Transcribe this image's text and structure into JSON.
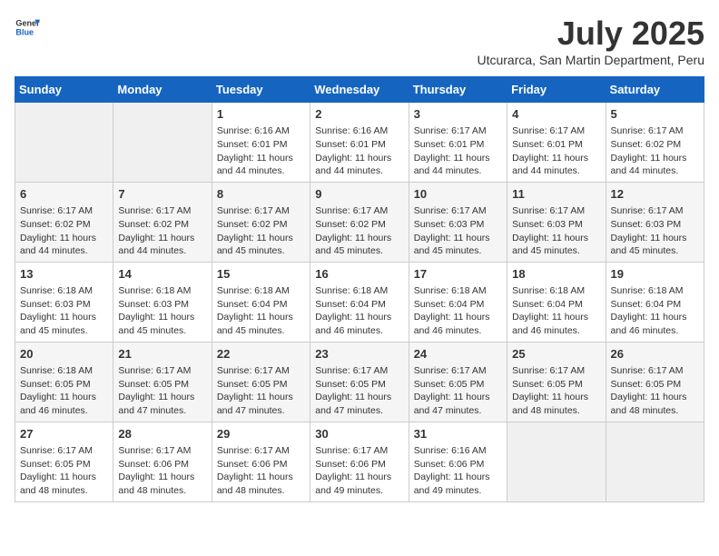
{
  "header": {
    "logo_general": "General",
    "logo_blue": "Blue",
    "month": "July 2025",
    "location": "Utcurarca, San Martin Department, Peru"
  },
  "days_of_week": [
    "Sunday",
    "Monday",
    "Tuesday",
    "Wednesday",
    "Thursday",
    "Friday",
    "Saturday"
  ],
  "weeks": [
    [
      {
        "day": "",
        "sunrise": "",
        "sunset": "",
        "daylight": ""
      },
      {
        "day": "",
        "sunrise": "",
        "sunset": "",
        "daylight": ""
      },
      {
        "day": "1",
        "sunrise": "Sunrise: 6:16 AM",
        "sunset": "Sunset: 6:01 PM",
        "daylight": "Daylight: 11 hours and 44 minutes."
      },
      {
        "day": "2",
        "sunrise": "Sunrise: 6:16 AM",
        "sunset": "Sunset: 6:01 PM",
        "daylight": "Daylight: 11 hours and 44 minutes."
      },
      {
        "day": "3",
        "sunrise": "Sunrise: 6:17 AM",
        "sunset": "Sunset: 6:01 PM",
        "daylight": "Daylight: 11 hours and 44 minutes."
      },
      {
        "day": "4",
        "sunrise": "Sunrise: 6:17 AM",
        "sunset": "Sunset: 6:01 PM",
        "daylight": "Daylight: 11 hours and 44 minutes."
      },
      {
        "day": "5",
        "sunrise": "Sunrise: 6:17 AM",
        "sunset": "Sunset: 6:02 PM",
        "daylight": "Daylight: 11 hours and 44 minutes."
      }
    ],
    [
      {
        "day": "6",
        "sunrise": "Sunrise: 6:17 AM",
        "sunset": "Sunset: 6:02 PM",
        "daylight": "Daylight: 11 hours and 44 minutes."
      },
      {
        "day": "7",
        "sunrise": "Sunrise: 6:17 AM",
        "sunset": "Sunset: 6:02 PM",
        "daylight": "Daylight: 11 hours and 44 minutes."
      },
      {
        "day": "8",
        "sunrise": "Sunrise: 6:17 AM",
        "sunset": "Sunset: 6:02 PM",
        "daylight": "Daylight: 11 hours and 45 minutes."
      },
      {
        "day": "9",
        "sunrise": "Sunrise: 6:17 AM",
        "sunset": "Sunset: 6:02 PM",
        "daylight": "Daylight: 11 hours and 45 minutes."
      },
      {
        "day": "10",
        "sunrise": "Sunrise: 6:17 AM",
        "sunset": "Sunset: 6:03 PM",
        "daylight": "Daylight: 11 hours and 45 minutes."
      },
      {
        "day": "11",
        "sunrise": "Sunrise: 6:17 AM",
        "sunset": "Sunset: 6:03 PM",
        "daylight": "Daylight: 11 hours and 45 minutes."
      },
      {
        "day": "12",
        "sunrise": "Sunrise: 6:17 AM",
        "sunset": "Sunset: 6:03 PM",
        "daylight": "Daylight: 11 hours and 45 minutes."
      }
    ],
    [
      {
        "day": "13",
        "sunrise": "Sunrise: 6:18 AM",
        "sunset": "Sunset: 6:03 PM",
        "daylight": "Daylight: 11 hours and 45 minutes."
      },
      {
        "day": "14",
        "sunrise": "Sunrise: 6:18 AM",
        "sunset": "Sunset: 6:03 PM",
        "daylight": "Daylight: 11 hours and 45 minutes."
      },
      {
        "day": "15",
        "sunrise": "Sunrise: 6:18 AM",
        "sunset": "Sunset: 6:04 PM",
        "daylight": "Daylight: 11 hours and 45 minutes."
      },
      {
        "day": "16",
        "sunrise": "Sunrise: 6:18 AM",
        "sunset": "Sunset: 6:04 PM",
        "daylight": "Daylight: 11 hours and 46 minutes."
      },
      {
        "day": "17",
        "sunrise": "Sunrise: 6:18 AM",
        "sunset": "Sunset: 6:04 PM",
        "daylight": "Daylight: 11 hours and 46 minutes."
      },
      {
        "day": "18",
        "sunrise": "Sunrise: 6:18 AM",
        "sunset": "Sunset: 6:04 PM",
        "daylight": "Daylight: 11 hours and 46 minutes."
      },
      {
        "day": "19",
        "sunrise": "Sunrise: 6:18 AM",
        "sunset": "Sunset: 6:04 PM",
        "daylight": "Daylight: 11 hours and 46 minutes."
      }
    ],
    [
      {
        "day": "20",
        "sunrise": "Sunrise: 6:18 AM",
        "sunset": "Sunset: 6:05 PM",
        "daylight": "Daylight: 11 hours and 46 minutes."
      },
      {
        "day": "21",
        "sunrise": "Sunrise: 6:17 AM",
        "sunset": "Sunset: 6:05 PM",
        "daylight": "Daylight: 11 hours and 47 minutes."
      },
      {
        "day": "22",
        "sunrise": "Sunrise: 6:17 AM",
        "sunset": "Sunset: 6:05 PM",
        "daylight": "Daylight: 11 hours and 47 minutes."
      },
      {
        "day": "23",
        "sunrise": "Sunrise: 6:17 AM",
        "sunset": "Sunset: 6:05 PM",
        "daylight": "Daylight: 11 hours and 47 minutes."
      },
      {
        "day": "24",
        "sunrise": "Sunrise: 6:17 AM",
        "sunset": "Sunset: 6:05 PM",
        "daylight": "Daylight: 11 hours and 47 minutes."
      },
      {
        "day": "25",
        "sunrise": "Sunrise: 6:17 AM",
        "sunset": "Sunset: 6:05 PM",
        "daylight": "Daylight: 11 hours and 48 minutes."
      },
      {
        "day": "26",
        "sunrise": "Sunrise: 6:17 AM",
        "sunset": "Sunset: 6:05 PM",
        "daylight": "Daylight: 11 hours and 48 minutes."
      }
    ],
    [
      {
        "day": "27",
        "sunrise": "Sunrise: 6:17 AM",
        "sunset": "Sunset: 6:05 PM",
        "daylight": "Daylight: 11 hours and 48 minutes."
      },
      {
        "day": "28",
        "sunrise": "Sunrise: 6:17 AM",
        "sunset": "Sunset: 6:06 PM",
        "daylight": "Daylight: 11 hours and 48 minutes."
      },
      {
        "day": "29",
        "sunrise": "Sunrise: 6:17 AM",
        "sunset": "Sunset: 6:06 PM",
        "daylight": "Daylight: 11 hours and 48 minutes."
      },
      {
        "day": "30",
        "sunrise": "Sunrise: 6:17 AM",
        "sunset": "Sunset: 6:06 PM",
        "daylight": "Daylight: 11 hours and 49 minutes."
      },
      {
        "day": "31",
        "sunrise": "Sunrise: 6:16 AM",
        "sunset": "Sunset: 6:06 PM",
        "daylight": "Daylight: 11 hours and 49 minutes."
      },
      {
        "day": "",
        "sunrise": "",
        "sunset": "",
        "daylight": ""
      },
      {
        "day": "",
        "sunrise": "",
        "sunset": "",
        "daylight": ""
      }
    ]
  ]
}
